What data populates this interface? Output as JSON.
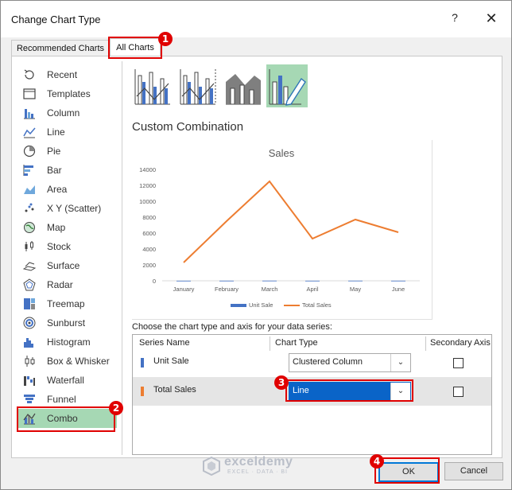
{
  "window": {
    "title": "Change Chart Type",
    "help_label": "?",
    "close_label": "✕"
  },
  "tabs": [
    {
      "label": "Recommended Charts"
    },
    {
      "label": "All Charts"
    }
  ],
  "sidebar": {
    "items": [
      {
        "label": "Recent",
        "icon": "recent-icon"
      },
      {
        "label": "Templates",
        "icon": "templates-icon"
      },
      {
        "label": "Column",
        "icon": "column-chart-icon"
      },
      {
        "label": "Line",
        "icon": "line-chart-icon"
      },
      {
        "label": "Pie",
        "icon": "pie-chart-icon"
      },
      {
        "label": "Bar",
        "icon": "bar-chart-icon"
      },
      {
        "label": "Area",
        "icon": "area-chart-icon"
      },
      {
        "label": "X Y (Scatter)",
        "icon": "scatter-chart-icon"
      },
      {
        "label": "Map",
        "icon": "map-chart-icon"
      },
      {
        "label": "Stock",
        "icon": "stock-chart-icon"
      },
      {
        "label": "Surface",
        "icon": "surface-chart-icon"
      },
      {
        "label": "Radar",
        "icon": "radar-chart-icon"
      },
      {
        "label": "Treemap",
        "icon": "treemap-chart-icon"
      },
      {
        "label": "Sunburst",
        "icon": "sunburst-chart-icon"
      },
      {
        "label": "Histogram",
        "icon": "histogram-chart-icon"
      },
      {
        "label": "Box & Whisker",
        "icon": "box-whisker-chart-icon"
      },
      {
        "label": "Waterfall",
        "icon": "waterfall-chart-icon"
      },
      {
        "label": "Funnel",
        "icon": "funnel-chart-icon"
      },
      {
        "label": "Combo",
        "icon": "combo-chart-icon",
        "selected": true
      }
    ]
  },
  "subtypes": [
    {
      "name": "clustered-column-line",
      "selected": false
    },
    {
      "name": "clustered-column-line-secondary-axis",
      "selected": false
    },
    {
      "name": "stacked-area-clustered-column",
      "selected": false
    },
    {
      "name": "custom-combination",
      "selected": true
    }
  ],
  "section_title": "Custom Combination",
  "chart_data": {
    "type": "line",
    "title": "Sales",
    "categories": [
      "January",
      "February",
      "March",
      "April",
      "May",
      "June"
    ],
    "series": [
      {
        "name": "Unit Sale",
        "color": "#4472c4",
        "values": [
          10,
          15,
          20,
          12,
          18,
          14
        ]
      },
      {
        "name": "Total Sales",
        "color": "#ed7d31",
        "values": [
          2300,
          7500,
          12500,
          5300,
          7700,
          6100
        ]
      }
    ],
    "ylim": [
      0,
      14000
    ],
    "yticks": [
      "14000",
      "12000",
      "10000",
      "8000",
      "6000",
      "4000",
      "2000",
      "0"
    ],
    "grid": false,
    "legend": "bottom"
  },
  "series_section": {
    "label": "Choose the chart type and axis for your data series:",
    "headers": {
      "name": "Series Name",
      "type": "Chart Type",
      "axis": "Secondary Axis"
    },
    "rows": [
      {
        "name": "Unit Sale",
        "color": "#4472c4",
        "chart_type": "Clustered Column",
        "secondary": false
      },
      {
        "name": "Total Sales",
        "color": "#ed7d31",
        "chart_type": "Line",
        "secondary": false
      }
    ]
  },
  "buttons": {
    "ok": "OK",
    "cancel": "Cancel"
  },
  "callouts": [
    "1",
    "2",
    "3",
    "4"
  ],
  "watermark": {
    "name": "exceldemy",
    "tag": "EXCEL · DATA · BI"
  }
}
